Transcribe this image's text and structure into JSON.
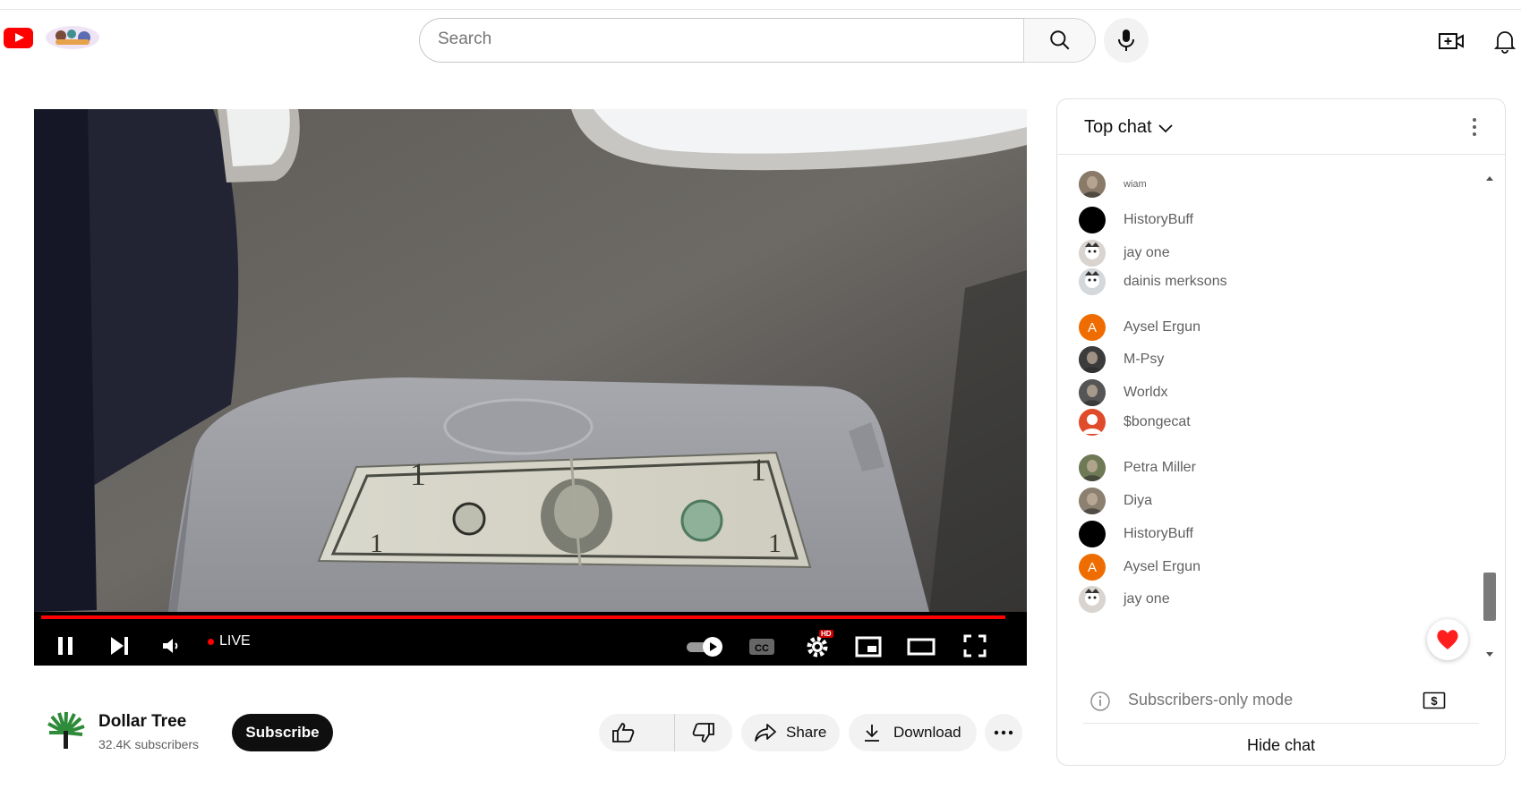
{
  "header": {
    "search_placeholder": "Search",
    "brand_color": "#ff0000",
    "icons": [
      "youtube-logo-icon",
      "doodle-icon",
      "search-icon",
      "mic-icon",
      "create-video-icon",
      "bell-icon"
    ]
  },
  "player": {
    "live_label": "LIVE",
    "hd_badge": "HD",
    "progress_color": "#ff0000",
    "icons": [
      "pause-icon",
      "next-icon",
      "volume-icon",
      "autoplay-toggle-icon",
      "cc-icon",
      "settings-icon",
      "miniplayer-icon",
      "theater-icon",
      "fullscreen-icon"
    ]
  },
  "channel": {
    "name": "Dollar Tree",
    "subscribers": "32.4K subscribers",
    "subscribe_label": "Subscribe"
  },
  "actions": {
    "share_label": "Share",
    "download_label": "Download"
  },
  "chat": {
    "title": "Top chat",
    "messages": [
      {
        "name": "wiam",
        "avatar": "photo",
        "color": "#8a7a6a"
      },
      {
        "name": "HistoryBuff",
        "avatar": "dark",
        "color": "#000000"
      },
      {
        "name": "jay one",
        "avatar": "anime",
        "color": "#d9d4cf"
      },
      {
        "name": "dainis merksons",
        "avatar": "dog",
        "color": "#d5d8da"
      },
      {
        "name": "Aysel Ergun",
        "avatar": "letter",
        "letter": "A",
        "color": "#ef6c00"
      },
      {
        "name": "M-Psy",
        "avatar": "photo",
        "color": "#3c3c3c"
      },
      {
        "name": "Worldx",
        "avatar": "photo",
        "color": "#555555"
      },
      {
        "name": "$bongecat",
        "avatar": "person",
        "color": "#e04b2a"
      },
      {
        "name": "Petra Miller",
        "avatar": "photo",
        "color": "#6e7a55"
      },
      {
        "name": "Diya",
        "avatar": "photo",
        "color": "#8c8070"
      },
      {
        "name": "HistoryBuff",
        "avatar": "dark",
        "color": "#000000"
      },
      {
        "name": "Aysel Ergun",
        "avatar": "letter",
        "letter": "A",
        "color": "#ef6c00"
      },
      {
        "name": "jay one",
        "avatar": "anime",
        "color": "#d9d4cf"
      }
    ],
    "subscribers_only_label": "Subscribers-only mode",
    "hide_chat_label": "Hide chat"
  }
}
